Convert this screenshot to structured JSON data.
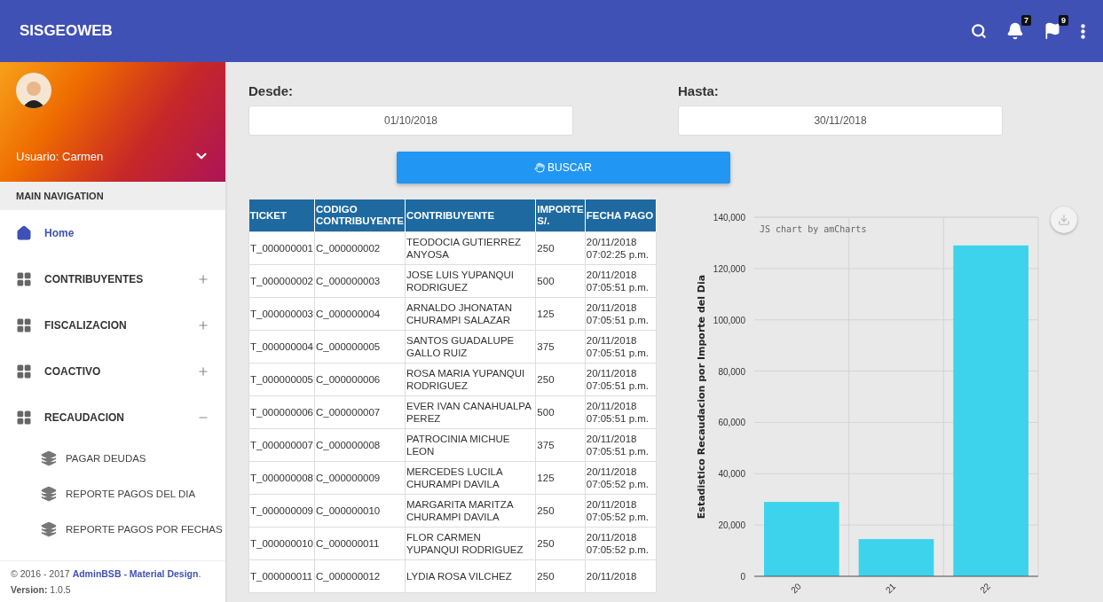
{
  "app_bar": {
    "title": "SISGEOWEB",
    "notifications": [
      {
        "kind": "bell",
        "count": "7"
      },
      {
        "kind": "flag",
        "count": "9"
      }
    ]
  },
  "sidebar": {
    "user": "Usuario: Carmen",
    "section": "MAIN NAVIGATION",
    "items": [
      {
        "label": "Home",
        "kind": "link",
        "selected": true
      },
      {
        "label": "CONTRIBUYENTES",
        "kind": "group",
        "selected": false,
        "expanded": false
      },
      {
        "label": "FISCALIZACION",
        "kind": "group",
        "selected": false,
        "expanded": false
      },
      {
        "label": "COACTIVO",
        "kind": "group",
        "selected": false,
        "expanded": false
      },
      {
        "label": "RECAUDACION",
        "kind": "group",
        "selected": false,
        "expanded": true,
        "children": [
          {
            "label": "PAGAR DEUDAS"
          },
          {
            "label": "REPORTE PAGOS DEL DIA"
          },
          {
            "label": "REPORTE PAGOS POR FECHAS"
          }
        ]
      }
    ],
    "footer": {
      "copyright": "© 2016 - 2017 ",
      "brand": "AdminBSB - Material Design",
      "period": ".",
      "version_label": "Version:",
      "version": "1.0.5"
    }
  },
  "filters": {
    "from_label": "Desde:",
    "from_value": "01/10/2018",
    "to_label": "Hasta:",
    "to_value": "30/11/2018",
    "search_button": "BUSCAR"
  },
  "table": {
    "columns": [
      "TICKET",
      "CODIGO CONTRIBUYENTE",
      "CONTRIBUYENTE",
      "IMPORTE S/.",
      "FECHA PAGO"
    ],
    "rows": [
      [
        "T_000000001",
        "C_000000002",
        "TEODOCIA GUTIERREZ ANYOSA",
        "250",
        "20/11/2018 07:02:25 p.m."
      ],
      [
        "T_000000002",
        "C_000000003",
        "JOSE LUIS YUPANQUI RODRIGUEZ",
        "500",
        "20/11/2018 07:05:51 p.m."
      ],
      [
        "T_000000003",
        "C_000000004",
        "ARNALDO JHONATAN CHURAMPI SALAZAR",
        "125",
        "20/11/2018 07:05:51 p.m."
      ],
      [
        "T_000000004",
        "C_000000005",
        "SANTOS GUADALUPE GALLO RUIZ",
        "375",
        "20/11/2018 07:05:51 p.m."
      ],
      [
        "T_000000005",
        "C_000000006",
        "ROSA MARIA YUPANQUI RODRIGUEZ",
        "250",
        "20/11/2018 07:05:51 p.m."
      ],
      [
        "T_000000006",
        "C_000000007",
        "EVER IVAN CANAHUALPA PEREZ",
        "500",
        "20/11/2018 07:05:51 p.m."
      ],
      [
        "T_000000007",
        "C_000000008",
        "PATROCINIA MICHUE LEON",
        "375",
        "20/11/2018 07:05:51 p.m."
      ],
      [
        "T_000000008",
        "C_000000009",
        "MERCEDES LUCILA CHURAMPI DAVILA",
        "125",
        "20/11/2018 07:05:52 p.m."
      ],
      [
        "T_000000009",
        "C_000000010",
        "MARGARITA MARITZA CHURAMPI DAVILA",
        "250",
        "20/11/2018 07:05:52 p.m."
      ],
      [
        "T_000000010",
        "C_000000011",
        "FLOR CARMEN YUPANQUI RODRIGUEZ",
        "250",
        "20/11/2018 07:05:52 p.m."
      ],
      [
        "T_000000011",
        "C_000000012",
        "LYDIA ROSA VILCHEZ",
        "250",
        "20/11/2018"
      ]
    ]
  },
  "chart": {
    "credit": "JS chart by amCharts",
    "chart_data": {
      "type": "bar",
      "ylabel": "Estadistico Recaudacion por Importe del Dia",
      "categories": [
        "20",
        "21",
        "22"
      ],
      "series": [
        {
          "color": "#3dd3ec",
          "values": [
            29000,
            14500,
            129000
          ]
        }
      ],
      "grid": true,
      "ylim": [
        0,
        140000
      ],
      "yticks": [
        {
          "value": 0,
          "label": "0"
        },
        {
          "value": 20000,
          "label": "20,000"
        },
        {
          "value": 40000,
          "label": "40,000"
        },
        {
          "value": 60000,
          "label": "60,000"
        },
        {
          "value": 80000,
          "label": "80,000"
        },
        {
          "value": 100000,
          "label": "100,000"
        },
        {
          "value": 120000,
          "label": "120,000"
        },
        {
          "value": 140000,
          "label": "140,000"
        }
      ]
    }
  }
}
